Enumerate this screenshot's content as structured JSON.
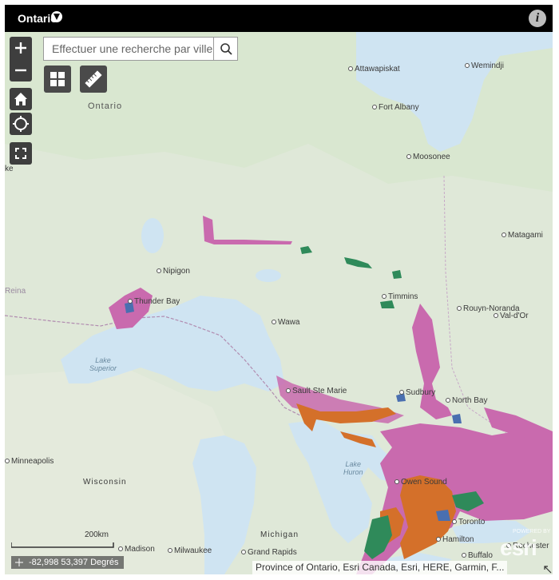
{
  "header": {
    "brand": "Ontario"
  },
  "search": {
    "placeholder": "Effectuer une recherche par ville"
  },
  "scale": {
    "label": "200km"
  },
  "coordinates": {
    "text": "-82,998 53,397 Degrés"
  },
  "attribution": {
    "text": "Province of Ontario, Esri Canada, Esri, HERE, Garmin, F..."
  },
  "esri": {
    "logo": "esri",
    "powered": "POWERED BY"
  },
  "places": [
    {
      "name": "Attawapiskat"
    },
    {
      "name": "Wemindji"
    },
    {
      "name": "Fort Albany"
    },
    {
      "name": "Moosonee"
    },
    {
      "name": "Matagami"
    },
    {
      "name": "Nipigon"
    },
    {
      "name": "Thunder Bay"
    },
    {
      "name": "Wawa"
    },
    {
      "name": "Timmins"
    },
    {
      "name": "Rouyn-Noranda"
    },
    {
      "name": "Val-d'Or"
    },
    {
      "name": "Sault Ste Marie"
    },
    {
      "name": "Sudbury"
    },
    {
      "name": "North Bay"
    },
    {
      "name": "Minneapolis"
    },
    {
      "name": "Wisconsin"
    },
    {
      "name": "Owen Sound"
    },
    {
      "name": "Toronto"
    },
    {
      "name": "Michigan"
    },
    {
      "name": "Madison"
    },
    {
      "name": "Milwaukee"
    },
    {
      "name": "Grand Rapids"
    },
    {
      "name": "Hamilton"
    },
    {
      "name": "Buffalo"
    },
    {
      "name": "Rochester"
    },
    {
      "name": "Reina"
    },
    {
      "name": "ke"
    }
  ],
  "regions": {
    "ontario": "Ontario"
  },
  "lakes": {
    "superior_1": "Lake",
    "superior_2": "Superior",
    "huron_1": "Lake",
    "huron_2": "Huron"
  },
  "colors": {
    "background": "#dfe8d8",
    "water": "#cfe4f2",
    "magenta": "#c96aae",
    "orange": "#d4702a",
    "green": "#2f8a5a",
    "blue": "#4a6fb0"
  }
}
